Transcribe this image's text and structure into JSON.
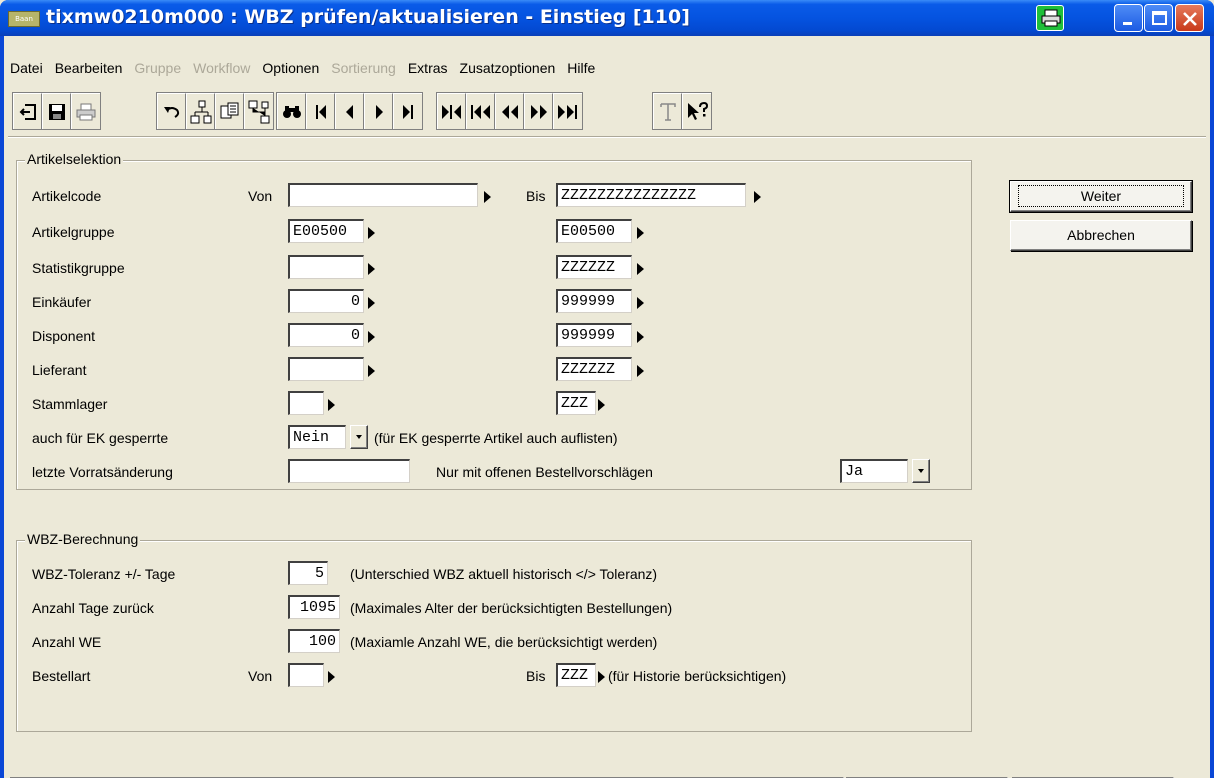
{
  "window": {
    "title": "tixmw0210m000 : WBZ prüfen/aktualisieren - Einstieg [110]",
    "app_icon_text": "Baan"
  },
  "menu": [
    {
      "label": "Datei",
      "enabled": true
    },
    {
      "label": "Bearbeiten",
      "enabled": true
    },
    {
      "label": "Gruppe",
      "enabled": false
    },
    {
      "label": "Workflow",
      "enabled": false
    },
    {
      "label": "Optionen",
      "enabled": true
    },
    {
      "label": "Sortierung",
      "enabled": false
    },
    {
      "label": "Extras",
      "enabled": true
    },
    {
      "label": "Zusatzoptionen",
      "enabled": true
    },
    {
      "label": "Hilfe",
      "enabled": true
    }
  ],
  "toolbar": {
    "icons": [
      "exit-icon",
      "save-icon",
      "print-icon",
      "undo-icon",
      "insert-child-icon",
      "copy-icon",
      "insert-parent-icon",
      "find-icon",
      "first-record-icon",
      "previous-record-icon",
      "next-record-icon",
      "last-record-icon",
      "first-set-icon",
      "previous-set-icon",
      "previous-group-icon",
      "next-group-icon",
      "last-group-icon",
      "text-icon",
      "help-pointer-icon"
    ]
  },
  "article_selection": {
    "legend": "Artikelselektion",
    "von_label": "Von",
    "bis_label": "Bis",
    "rows": [
      {
        "label": "Artikelcode",
        "from": "",
        "to": "ZZZZZZZZZZZZZZZ"
      },
      {
        "label": "Artikelgruppe",
        "from": "E00500",
        "to": "E00500"
      },
      {
        "label": "Statistikgruppe",
        "from": "",
        "to": "ZZZZZZ"
      },
      {
        "label": "Einkäufer",
        "from": "0",
        "to": "999999"
      },
      {
        "label": "Disponent",
        "from": "0",
        "to": "999999"
      },
      {
        "label": "Lieferant",
        "from": "",
        "to": "ZZZZZZ"
      },
      {
        "label": "Stammlager",
        "from": "",
        "to": "ZZZ"
      }
    ],
    "blocked": {
      "label": "auch für EK gesperrte",
      "value": "Nein",
      "hint": "(für EK gesperrte Artikel auch auflisten)"
    },
    "last_change": {
      "label": "letzte Vorratsänderung",
      "value": ""
    },
    "open_proposals": {
      "label": "Nur mit offenen Bestellvorschlägen",
      "value": "Ja"
    }
  },
  "wbz_calc": {
    "legend": "WBZ-Berechnung",
    "tolerance": {
      "label": "WBZ-Toleranz +/- Tage",
      "value": "5",
      "hint": "(Unterschied WBZ aktuell  historisch </> Toleranz)"
    },
    "days_back": {
      "label": "Anzahl Tage zurück",
      "value": "1095",
      "hint": "(Maximales Alter der berücksichtigten Bestellungen)"
    },
    "we_count": {
      "label": "Anzahl WE",
      "value": "100",
      "hint": "(Maxiamle Anzahl WE, die berücksichtigt werden)"
    },
    "order_type": {
      "label": "Bestellart",
      "von_label": "Von",
      "from": "",
      "bis_label": "Bis",
      "to": "ZZZ",
      "hint": "(für Historie berücksichtigen)"
    }
  },
  "buttons": {
    "continue": "Weiter",
    "cancel": "Abbrechen"
  },
  "status": {
    "left": "",
    "mid": "",
    "right": ""
  }
}
